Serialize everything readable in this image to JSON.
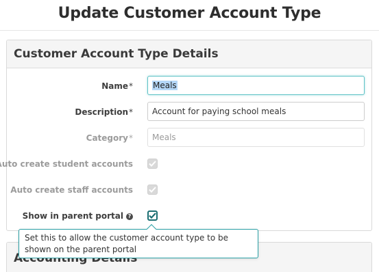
{
  "page": {
    "title": "Update Customer Account Type"
  },
  "details_panel": {
    "heading": "Customer Account Type Details",
    "fields": {
      "name": {
        "label": "Name",
        "required_mark": "*",
        "value": "Meals"
      },
      "description": {
        "label": "Description",
        "required_mark": "*",
        "value": "Account for paying school meals"
      },
      "category": {
        "label": "Category",
        "required_mark": "*",
        "value": "Meals"
      },
      "auto_student": {
        "label": "Auto create student accounts",
        "checked": true,
        "disabled": true
      },
      "auto_staff": {
        "label": "Auto create staff accounts",
        "checked": true,
        "disabled": true
      },
      "show_portal": {
        "label": "Show in parent portal",
        "help_icon": "question-mark-icon",
        "help_glyph": "?",
        "checked": true,
        "disabled": false
      }
    }
  },
  "tooltip": {
    "text": "Set this to allow the customer account type to be shown on the parent portal"
  },
  "accounting_panel": {
    "heading": "Accounting Details"
  },
  "colors": {
    "accent": "#2aa0a6",
    "focus": "#5fc2c6",
    "checkbox_active": "#1b6f73",
    "disabled_text": "#9b9b9b"
  }
}
